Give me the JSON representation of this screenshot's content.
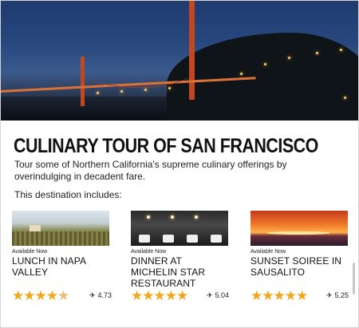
{
  "tour": {
    "title": "CULINARY TOUR OF SAN FRANCISCO",
    "description": "Tour some of Northern California's supreme culinary offerings by overindulging in decadent fare.",
    "includes_label": "This destination includes:"
  },
  "cards": [
    {
      "availability": "Available Now",
      "name": "LUNCH IN NAPA VALLEY",
      "rating": 4.5,
      "score": "4.73",
      "icon": "plane-icon"
    },
    {
      "availability": "Available Now",
      "name": "DINNER AT MICHELIN STAR RESTAURANT",
      "rating": 5,
      "score": "5.04",
      "icon": "plane-icon"
    },
    {
      "availability": "Available Now",
      "name": "SUNSET SOIREE IN SAUSALITO",
      "rating": 5,
      "score": "5.25",
      "icon": "plane-icon"
    }
  ],
  "colors": {
    "star": "#f2a71b",
    "text": "#111111"
  }
}
